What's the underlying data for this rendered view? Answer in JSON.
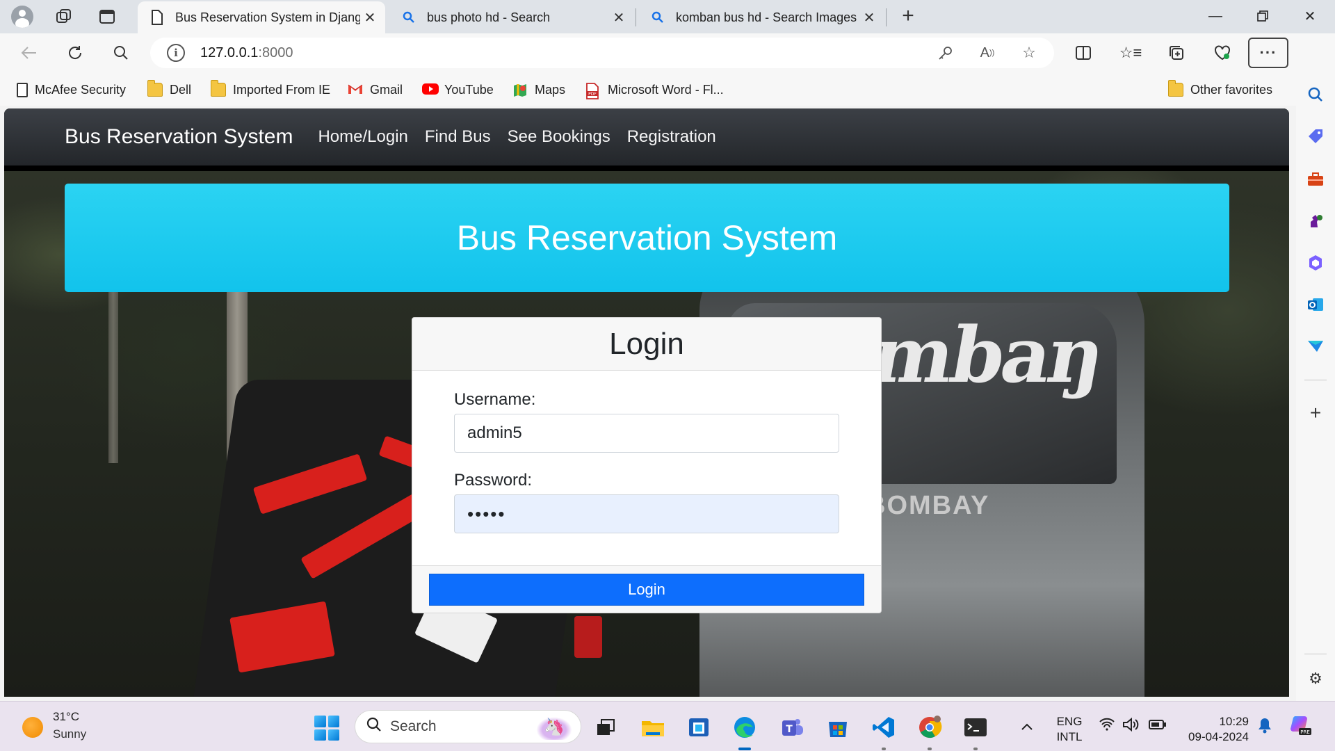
{
  "browser": {
    "tabs": [
      {
        "title": "Bus Reservation System in Django",
        "active": true,
        "icon": "page-icon"
      },
      {
        "title": "bus photo hd - Search",
        "active": false,
        "icon": "search-icon"
      },
      {
        "title": "komban bus hd - Search Images",
        "active": false,
        "icon": "search-icon"
      }
    ],
    "url_host": "127.0.0.1",
    "url_port": ":8000",
    "favorites": [
      {
        "label": "McAfee Security",
        "icon": "page-icon"
      },
      {
        "label": "Dell",
        "icon": "folder-icon"
      },
      {
        "label": "Imported From IE",
        "icon": "folder-icon"
      },
      {
        "label": "Gmail",
        "icon": "gmail-icon"
      },
      {
        "label": "YouTube",
        "icon": "youtube-icon"
      },
      {
        "label": "Maps",
        "icon": "maps-icon"
      },
      {
        "label": "Microsoft Word - Fl...",
        "icon": "pdf-icon"
      }
    ],
    "other_favorites": "Other favorites",
    "sidebar_icons": [
      "search-icon",
      "tag-icon",
      "toolbox-icon",
      "chess-icon",
      "copilot-icon",
      "outlook-icon",
      "send-icon",
      "add-icon",
      "settings-icon"
    ]
  },
  "site": {
    "brand": "Bus Reservation System",
    "nav": [
      "Home/Login",
      "Find Bus",
      "See Bookings",
      "Registration"
    ],
    "hero_title": "Bus Reservation System",
    "hero_color": "#1fcbef",
    "login": {
      "title": "Login",
      "username_label": "Username:",
      "username_value": "admin5",
      "password_label": "Password:",
      "password_value": "•••••",
      "button": "Login",
      "button_color": "#0d6efd"
    }
  },
  "taskbar": {
    "weather_temp": "31°C",
    "weather_condition": "Sunny",
    "search_placeholder": "Search",
    "lang_top": "ENG",
    "lang_bottom": "INTL",
    "time": "10:29",
    "date": "09-04-2024"
  }
}
